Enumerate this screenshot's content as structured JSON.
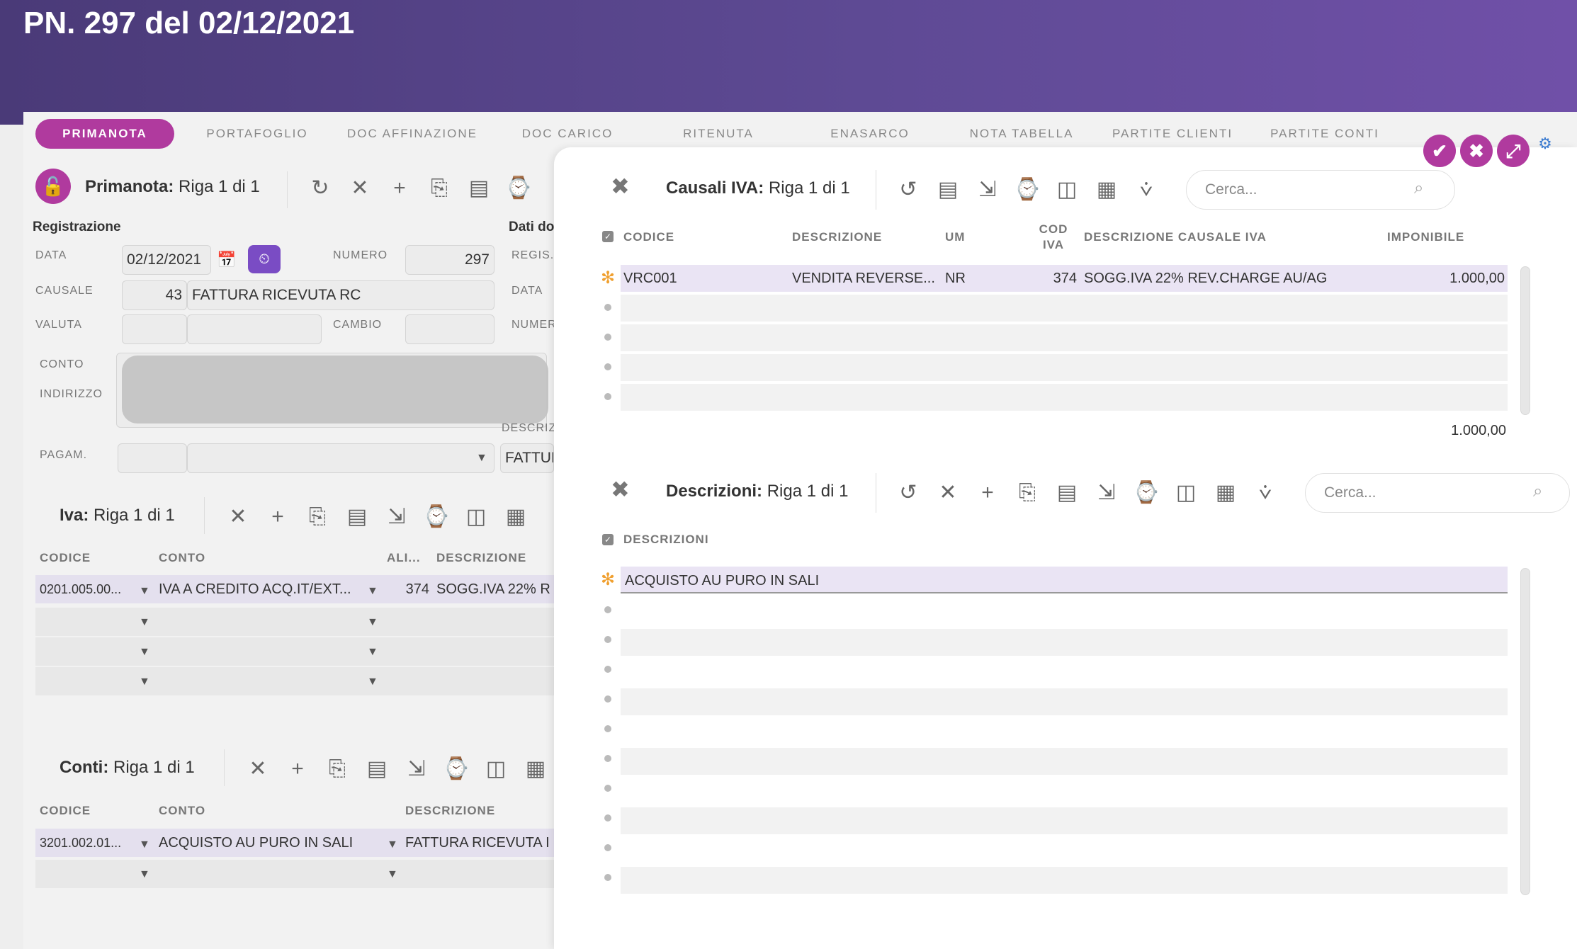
{
  "page": {
    "title": "PN. 297 del 02/12/2021"
  },
  "tabs": [
    "PRIMANOTA",
    "PORTAFOGLIO",
    "DOC AFFINAZIONE",
    "DOC CARICO",
    "RITENUTA",
    "ENASARCO",
    "NOTA TABELLA",
    "PARTITE CLIENTI",
    "PARTITE CONTI"
  ],
  "primanota": {
    "label": "Primanota:",
    "row_info": "Riga 1 di 1",
    "section_registrazione": "Registrazione",
    "section_dati": "Dati do",
    "data_label": "DATA",
    "data_value": "02/12/2021",
    "numero_label": "NUMERO",
    "numero_value": "297",
    "causale_label": "CAUSALE",
    "causale_code": "43",
    "causale_desc": "FATTURA RICEVUTA RC",
    "valuta_label": "VALUTA",
    "cambio_label": "CAMBIO",
    "conto_label": "CONTO",
    "indirizzo_label": "INDIRIZZO",
    "pagam_label": "PAGAM.",
    "regis_label": "REGIS.",
    "data2_label": "DATA",
    "numer_label": "NUMER",
    "descr_label": "DESCRIZ",
    "descr_value": "FATTUR"
  },
  "iva": {
    "label": "Iva:",
    "row_info": "Riga 1 di 1",
    "columns": [
      "CODICE",
      "CONTO",
      "ALI...",
      "DESCRIZIONE"
    ],
    "row": {
      "codice": "0201.005.00...",
      "conto": "IVA A CREDITO ACQ.IT/EXT...",
      "ali": "374",
      "descrizione": "SOGG.IVA 22% R"
    }
  },
  "conti": {
    "label": "Conti:",
    "row_info": "Riga 1 di 1",
    "columns": [
      "CODICE",
      "CONTO",
      "DESCRIZIONE"
    ],
    "row": {
      "codice": "3201.002.01...",
      "conto": "ACQUISTO AU PURO IN SALI",
      "descrizione": "FATTURA RICEVUTA I"
    }
  },
  "causali_iva": {
    "label": "Causali IVA:",
    "row_info": "Riga 1 di 1",
    "search_placeholder": "Cerca...",
    "columns": {
      "codice": "CODICE",
      "descrizione": "DESCRIZIONE",
      "um": "UM",
      "cod_iva_1": "COD",
      "cod_iva_2": "IVA",
      "desc_causale": "DESCRIZIONE CAUSALE IVA",
      "imponibile": "IMPONIBILE"
    },
    "row": {
      "codice": "VRC001",
      "descrizione": "VENDITA REVERSE...",
      "um": "NR",
      "cod_iva": "374",
      "desc_causale": "SOGG.IVA 22% REV.CHARGE AU/AG",
      "imponibile": "1.000,00"
    },
    "total": "1.000,00"
  },
  "descrizioni": {
    "label": "Descrizioni:",
    "row_info": "Riga 1 di 1",
    "search_placeholder": "Cerca...",
    "column": "DESCRIZIONI",
    "row": "ACQUISTO AU PURO IN SALI"
  },
  "colors": {
    "header": "#5e4a94",
    "accent": "#b03a9e",
    "selected_row": "#eae4f4",
    "star": "#f0a030"
  }
}
